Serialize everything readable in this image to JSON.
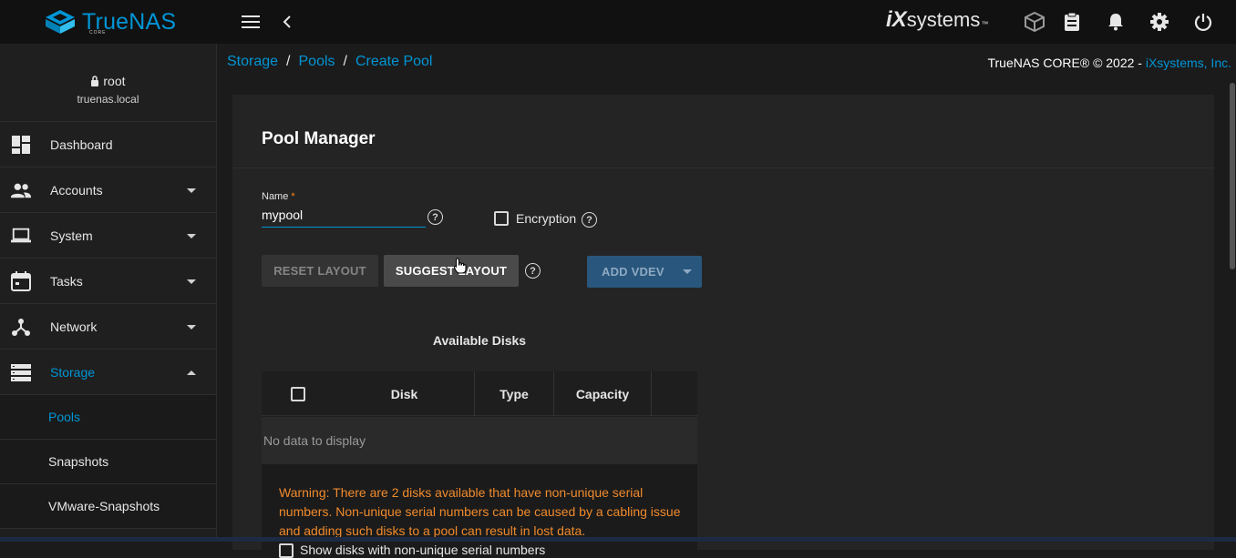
{
  "topbar": {
    "logo_text": "TrueNAS",
    "logo_sub": "CORE",
    "vendor_text": "systems",
    "vendor_mark": "iX",
    "icons": [
      "menu-icon",
      "back-chevron-icon",
      "truecommand-icon",
      "task-manager-icon",
      "notification-bell-icon",
      "settings-gear-icon",
      "power-icon"
    ]
  },
  "sidebar": {
    "user": "root",
    "host": "truenas.local",
    "items": [
      {
        "label": "Dashboard",
        "icon": "dashboard-icon"
      },
      {
        "label": "Accounts",
        "icon": "accounts-icon"
      },
      {
        "label": "System",
        "icon": "laptop-icon"
      },
      {
        "label": "Tasks",
        "icon": "calendar-icon"
      },
      {
        "label": "Network",
        "icon": "network-icon"
      },
      {
        "label": "Storage",
        "icon": "storage-icon"
      }
    ],
    "sub_items": [
      {
        "label": "Pools"
      },
      {
        "label": "Snapshots"
      },
      {
        "label": "VMware-Snapshots"
      }
    ]
  },
  "breadcrumb": {
    "items": [
      "Storage",
      "Pools",
      "Create Pool"
    ],
    "separator": "/"
  },
  "copyright": {
    "text": "TrueNAS CORE® © 2022 - ",
    "link": "iXsystems, Inc."
  },
  "pool_manager": {
    "title": "Pool Manager",
    "name_label": "Name",
    "required_mark": "*",
    "name_value": "mypool",
    "encryption_label": "Encryption",
    "reset_label": "RESET LAYOUT",
    "suggest_label": "SUGGEST LAYOUT",
    "add_vdev_label": "ADD VDEV",
    "available_title": "Available Disks",
    "columns": [
      "Disk",
      "Type",
      "Capacity"
    ],
    "empty_text": "No data to display",
    "warning": "Warning: There are 2 disks available that have non-unique serial numbers. Non-unique serial numbers can be caused by a cabling issue and adding such disks to a pool can result in lost data.",
    "show_nonunique_label": "Show disks with non-unique serial numbers"
  },
  "colors": {
    "accent": "#0095d5",
    "warning": "#f08a2c",
    "primary_button": "#29567c"
  }
}
